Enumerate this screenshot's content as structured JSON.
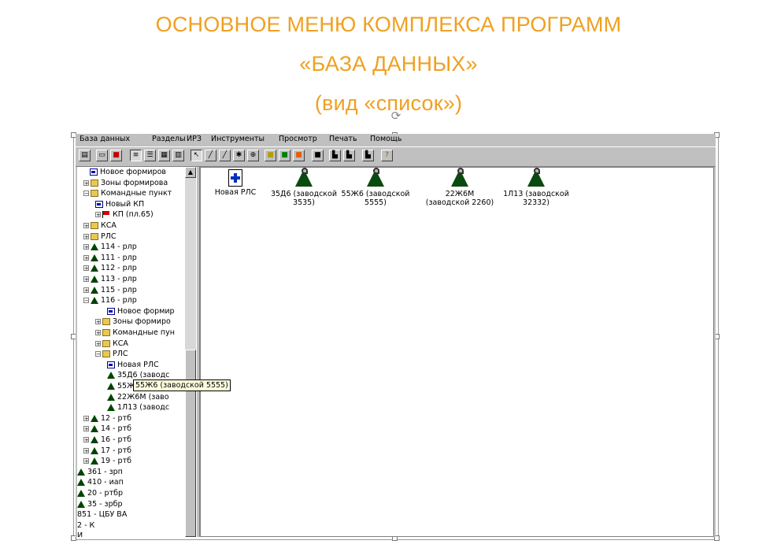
{
  "slide": {
    "title_line1": "ОСНОВНОЕ МЕНЮ КОМПЛЕКСА ПРОГРАММ",
    "title_line2": "«БАЗА ДАННЫХ»",
    "title_line3": "(вид «список»)",
    "title_color": "#f0a020"
  },
  "menu": [
    "База данных",
    "Разделы",
    "ИРЗ",
    "Инструменты",
    "Просмотр",
    "Печать",
    "Помощь"
  ],
  "tree": [
    {
      "label": "Новое формиров",
      "icon": "doc-icon"
    },
    {
      "label": "Зоны формирова",
      "icon": "folder-icon"
    },
    {
      "label": "Командные пункт",
      "icon": "folder-icon"
    },
    {
      "label": "Новый КП",
      "icon": "doc-icon"
    },
    {
      "label": "КП (пл.65)",
      "icon": "flag-icon"
    },
    {
      "label": "КСА",
      "icon": "folder-icon"
    },
    {
      "label": "РЛС",
      "icon": "folder-icon"
    },
    {
      "label": "114 - рлр",
      "icon": "unit-icon"
    },
    {
      "label": "111 - рлр",
      "icon": "unit-icon"
    },
    {
      "label": "112 - рлр",
      "icon": "unit-icon"
    },
    {
      "label": "113 - рлр",
      "icon": "unit-icon"
    },
    {
      "label": "115 - рлр",
      "icon": "unit-icon"
    },
    {
      "label": "116 - рлр",
      "icon": "unit-icon"
    },
    {
      "label": "Новое формир",
      "icon": "doc-icon"
    },
    {
      "label": "Зоны формиро",
      "icon": "folder-icon"
    },
    {
      "label": "Командные пун",
      "icon": "folder-icon"
    },
    {
      "label": "КСА",
      "icon": "folder-icon"
    },
    {
      "label": "РЛС",
      "icon": "folder-icon"
    },
    {
      "label": "Новая РЛС",
      "icon": "doc-icon"
    },
    {
      "label": "35Д6 (заводс",
      "icon": "unit-icon"
    },
    {
      "label": "55Ж6 (заводской 5555)",
      "icon": "unit-icon"
    },
    {
      "label": "22Ж6М (заво",
      "icon": "unit-icon"
    },
    {
      "label": "1Л13 (заводс",
      "icon": "unit-icon"
    },
    {
      "label": "12 - ртб",
      "icon": "unit-icon"
    },
    {
      "label": "14 - ртб",
      "icon": "unit-icon"
    },
    {
      "label": "16 - ртб",
      "icon": "unit-icon"
    },
    {
      "label": "17 - ртб",
      "icon": "unit-icon"
    },
    {
      "label": "19 - ртб",
      "icon": "unit-icon"
    },
    {
      "label": "361 - зрп",
      "icon": "unit-icon"
    },
    {
      "label": "410 - иап",
      "icon": "unit-icon"
    },
    {
      "label": "20 - ртбр",
      "icon": "unit-icon"
    },
    {
      "label": "35 - зрбр",
      "icon": "unit-icon"
    },
    {
      "label": "851 - ЦБУ ВА",
      "icon": ""
    },
    {
      "label": "2 - К",
      "icon": ""
    },
    {
      "label": "И",
      "icon": ""
    }
  ],
  "tooltip": "55Ж6 (заводской 5555)",
  "content_items": [
    {
      "line1": "Новая РЛС",
      "line2": "",
      "icon": "new-radar-icon"
    },
    {
      "line1": "35Д6 (заводской",
      "line2": "3535)",
      "icon": "radar-icon"
    },
    {
      "line1": "55Ж6 (заводской",
      "line2": "5555)",
      "icon": "radar-icon"
    },
    {
      "line1": "22Ж6М",
      "line2": "(заводской 2260)",
      "icon": "radar-icon"
    },
    {
      "line1": "1Л13 (заводской",
      "line2": "32332)",
      "icon": "radar-icon"
    }
  ],
  "toolbar_icons": [
    "open-icon",
    "folder-icon",
    "color-icon",
    "list-icon",
    "details-icon",
    "grid-icon",
    "tile-icon",
    "pointer-icon",
    "line-icon",
    "line2-icon",
    "node-icon",
    "target-icon",
    "yellow-icon",
    "green-icon",
    "orange-icon",
    "stop-icon",
    "chart-icon",
    "chart2-icon",
    "export-icon",
    "help-icon"
  ]
}
